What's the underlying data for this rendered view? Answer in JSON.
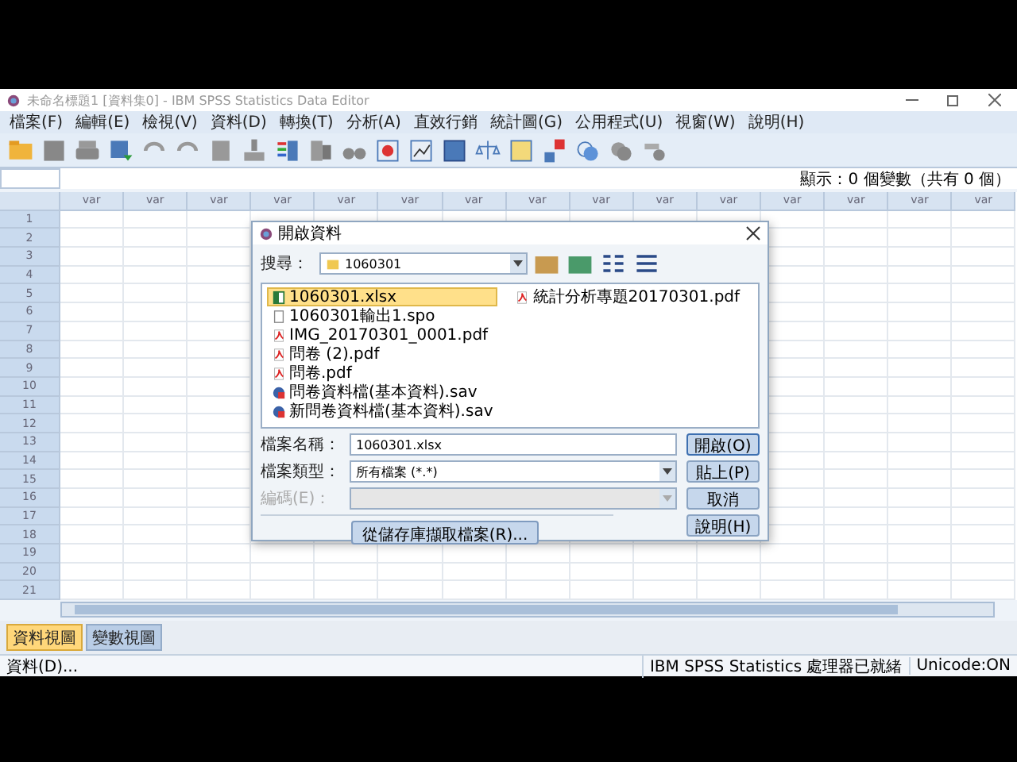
{
  "window": {
    "title": "未命名標題1 [資料集0] - IBM SPSS Statistics Data Editor"
  },
  "menu": [
    "檔案(F)",
    "編輯(E)",
    "檢視(V)",
    "資料(D)",
    "轉換(T)",
    "分析(A)",
    "直效行銷",
    "統計圖(G)",
    "公用程式(U)",
    "視窗(W)",
    "說明(H)"
  ],
  "display_info": "顯示：0 個變數（共有 0 個）",
  "grid": {
    "columns": [
      "var",
      "var",
      "var",
      "var",
      "var",
      "var",
      "var",
      "var",
      "var",
      "var",
      "var",
      "var",
      "var",
      "var",
      "var"
    ],
    "rows": [
      "1",
      "2",
      "3",
      "4",
      "5",
      "6",
      "7",
      "8",
      "9",
      "10",
      "11",
      "12",
      "13",
      "14",
      "15",
      "16",
      "17",
      "18",
      "19",
      "20",
      "21"
    ]
  },
  "view_tabs": [
    {
      "label": "資料視圖",
      "selected": true
    },
    {
      "label": "變數視圖",
      "selected": false
    }
  ],
  "status_bar": [
    "資料(D)...",
    "IBM SPSS Statistics 處理器已就緒",
    "Unicode:ON"
  ],
  "dialog": {
    "title": "開啟資料",
    "look_in_label": "搜尋：",
    "look_in_value": "1060301",
    "files": [
      {
        "name": "1060301.xlsx",
        "kind": "xlsx",
        "selected": true
      },
      {
        "name": "1060301輸出1.spo",
        "kind": "spo",
        "selected": false
      },
      {
        "name": "IMG_20170301_0001.pdf",
        "kind": "pdf",
        "selected": false
      },
      {
        "name": "問卷 (2).pdf",
        "kind": "pdf",
        "selected": false
      },
      {
        "name": "問卷.pdf",
        "kind": "pdf",
        "selected": false
      },
      {
        "name": "問卷資料檔(基本資料).sav",
        "kind": "sav",
        "selected": false
      },
      {
        "name": "新問卷資料檔(基本資料).sav",
        "kind": "sav",
        "selected": false
      },
      {
        "name": "統計分析專題20170301.pdf",
        "kind": "pdf",
        "selected": false
      }
    ],
    "fields": [
      {
        "label": "檔案名稱：",
        "value": "1060301.xlsx",
        "kind": "text",
        "disabled": false
      },
      {
        "label": "檔案類型：",
        "value": "所有檔案 (*.*)",
        "kind": "select",
        "disabled": false
      },
      {
        "label": "編碼(E)：",
        "kind": "select",
        "disabled": true
      }
    ],
    "buttons": [
      {
        "label": "開啟(O)",
        "default": true
      },
      {
        "label": "貼上(P)",
        "default": false
      },
      {
        "label": "取消",
        "default": false
      },
      {
        "label": "說明(H)",
        "default": false
      }
    ],
    "retrieve_button": "從儲存庫擷取檔案(R)..."
  }
}
